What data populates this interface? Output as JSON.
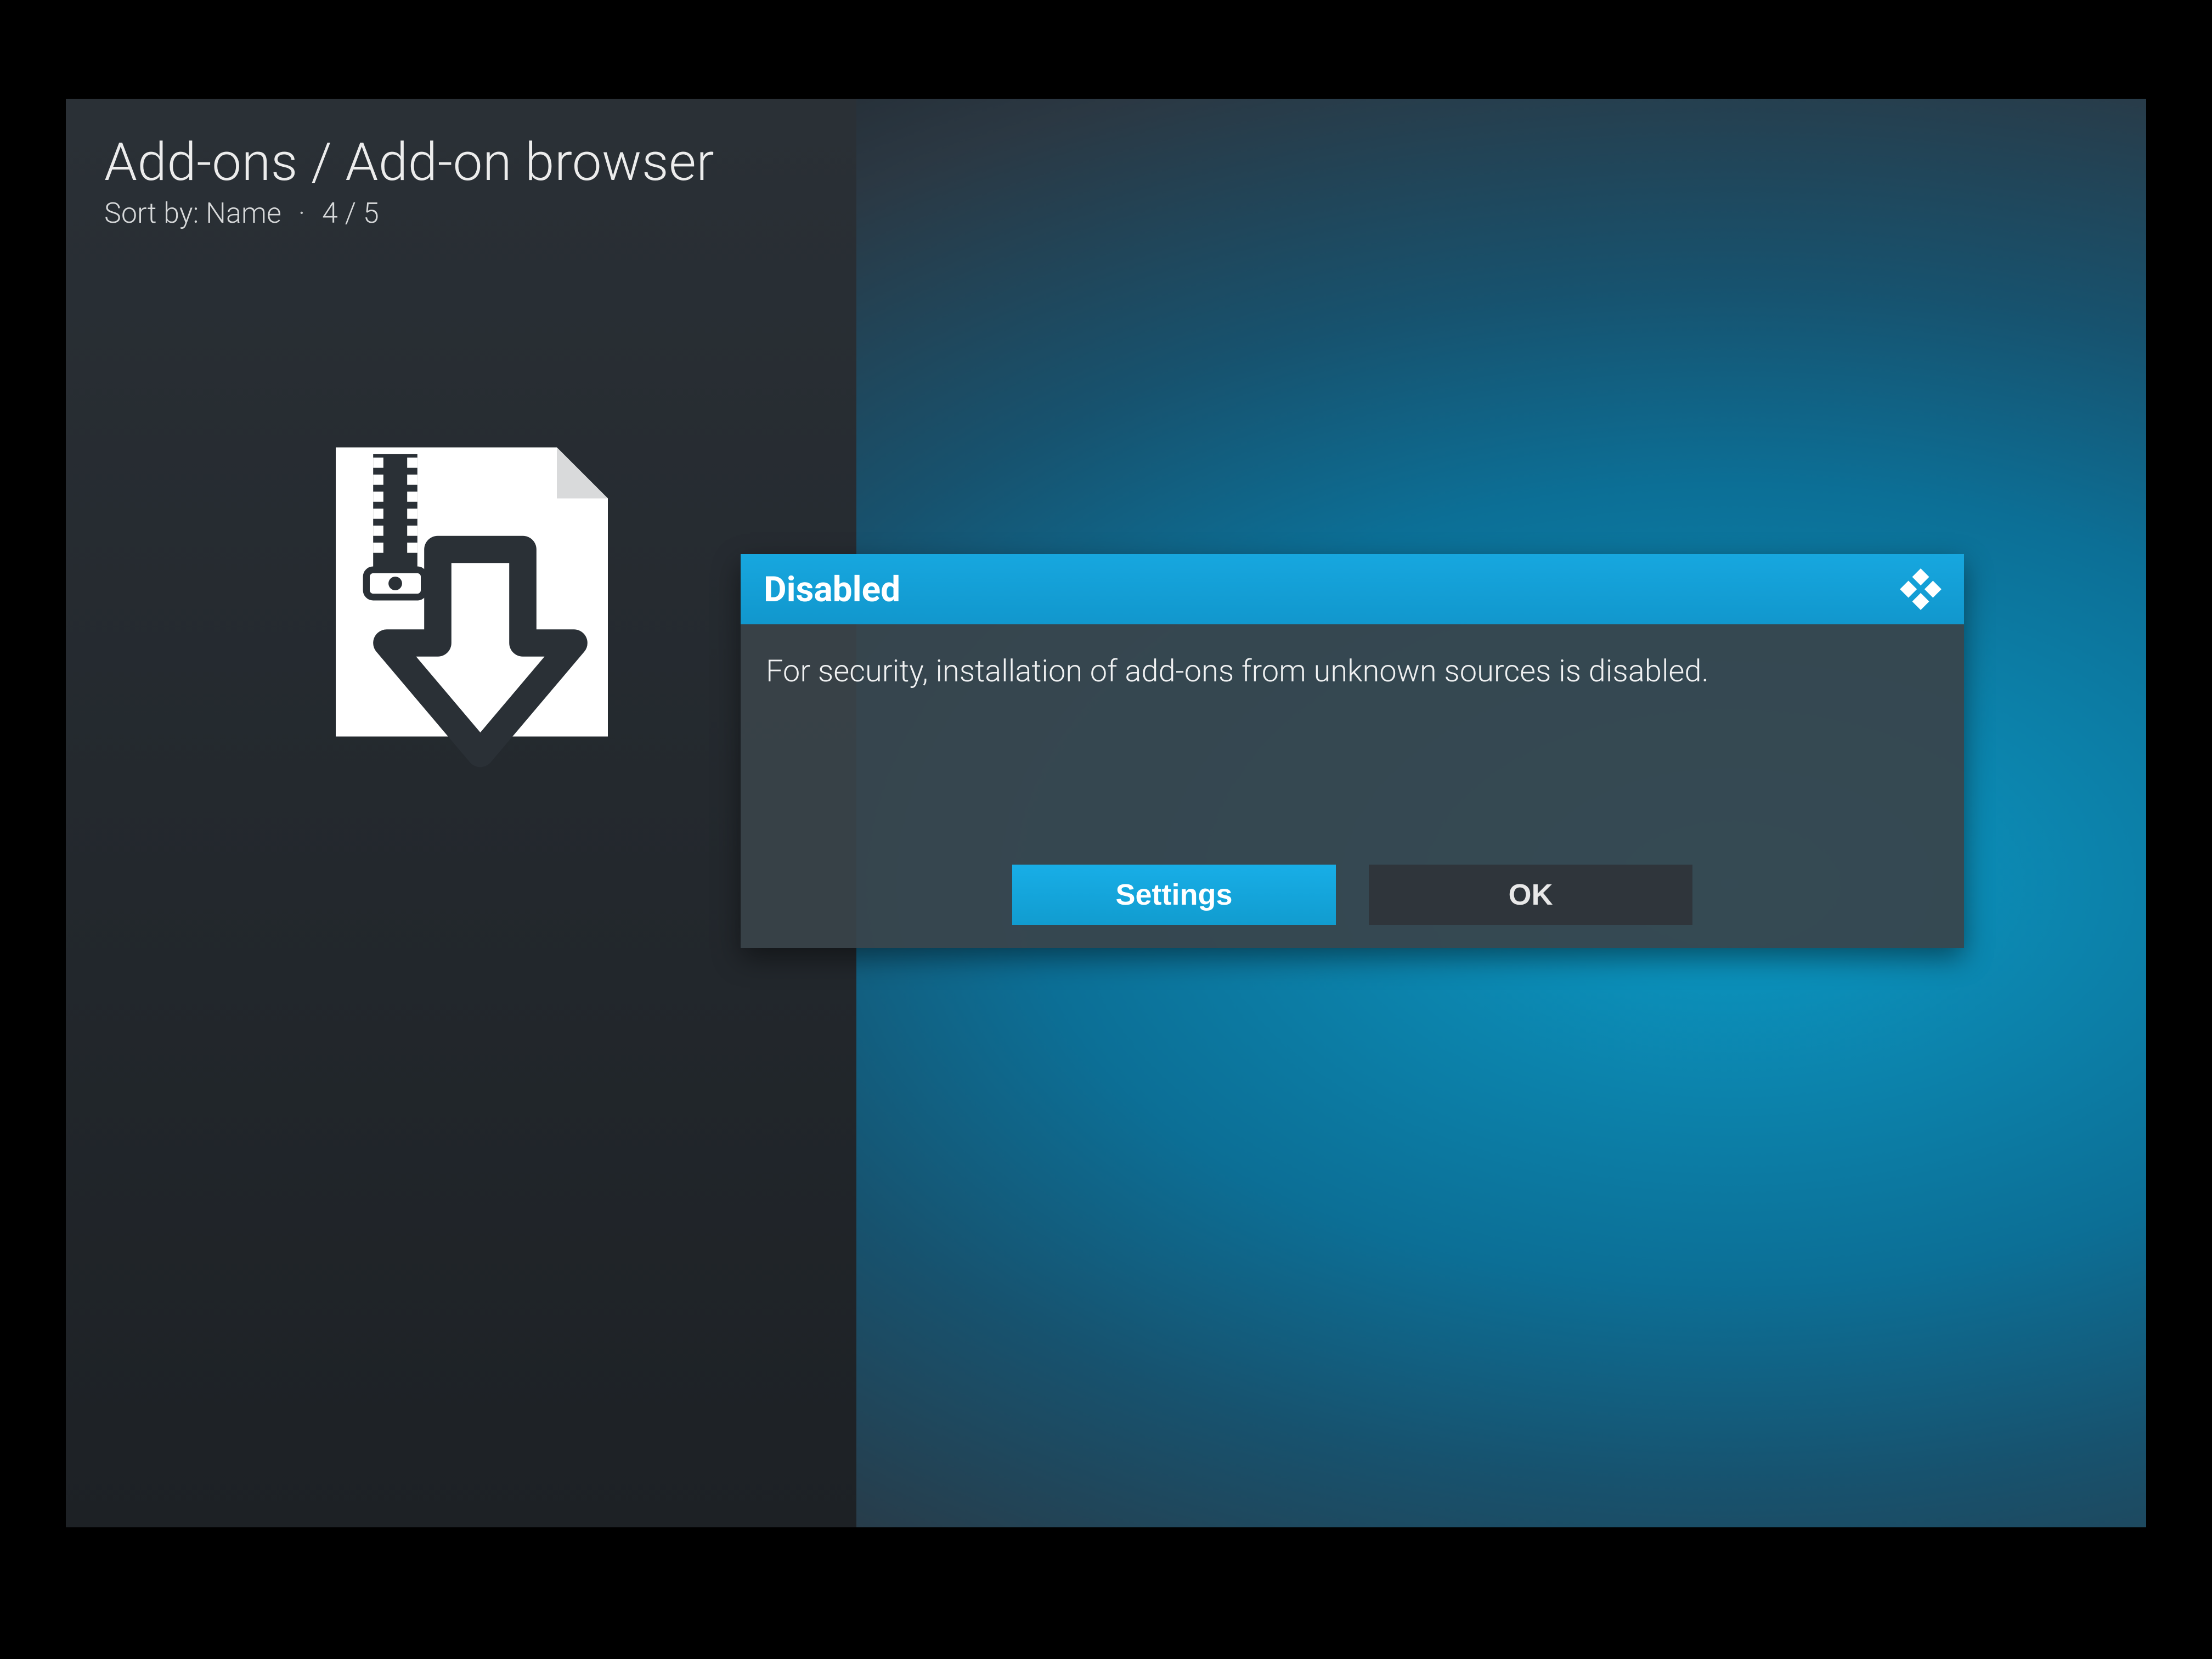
{
  "header": {
    "breadcrumb": "Add-ons / Add-on browser",
    "sort_label": "Sort by: Name",
    "position": "4 / 5"
  },
  "selected_item": {
    "icon": "zip-install-icon"
  },
  "dialog": {
    "title": "Disabled",
    "message": "For security, installation of add-ons from unknown sources is disabled.",
    "buttons": {
      "settings": "Settings",
      "ok": "OK"
    },
    "logo": "kodi-logo"
  },
  "colors": {
    "accent": "#12a3db",
    "panel": "#3a434a",
    "button_dark": "#2f353b"
  }
}
